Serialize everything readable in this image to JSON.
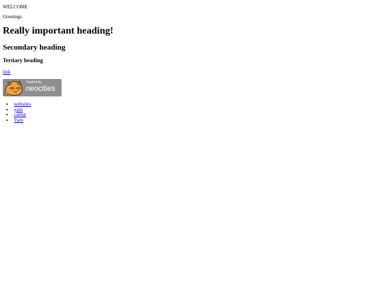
{
  "page": {
    "welcome": "WELCOME",
    "greetings": "Greetings",
    "heading1": "Really important heading!",
    "heading2": "Secondary heading",
    "heading3": "Tertiary heading",
    "link": "link",
    "badge": {
      "hosted_by": "hosted by",
      "neocities": "neocities",
      "icon": "neocities-cat-icon"
    },
    "list": [
      "websites",
      "yarn",
      "catnip",
      "Yarn"
    ]
  },
  "colors": {
    "link": "#0000ee",
    "badge_bg": "#8f8f8f",
    "badge_text": "#ffffff"
  }
}
